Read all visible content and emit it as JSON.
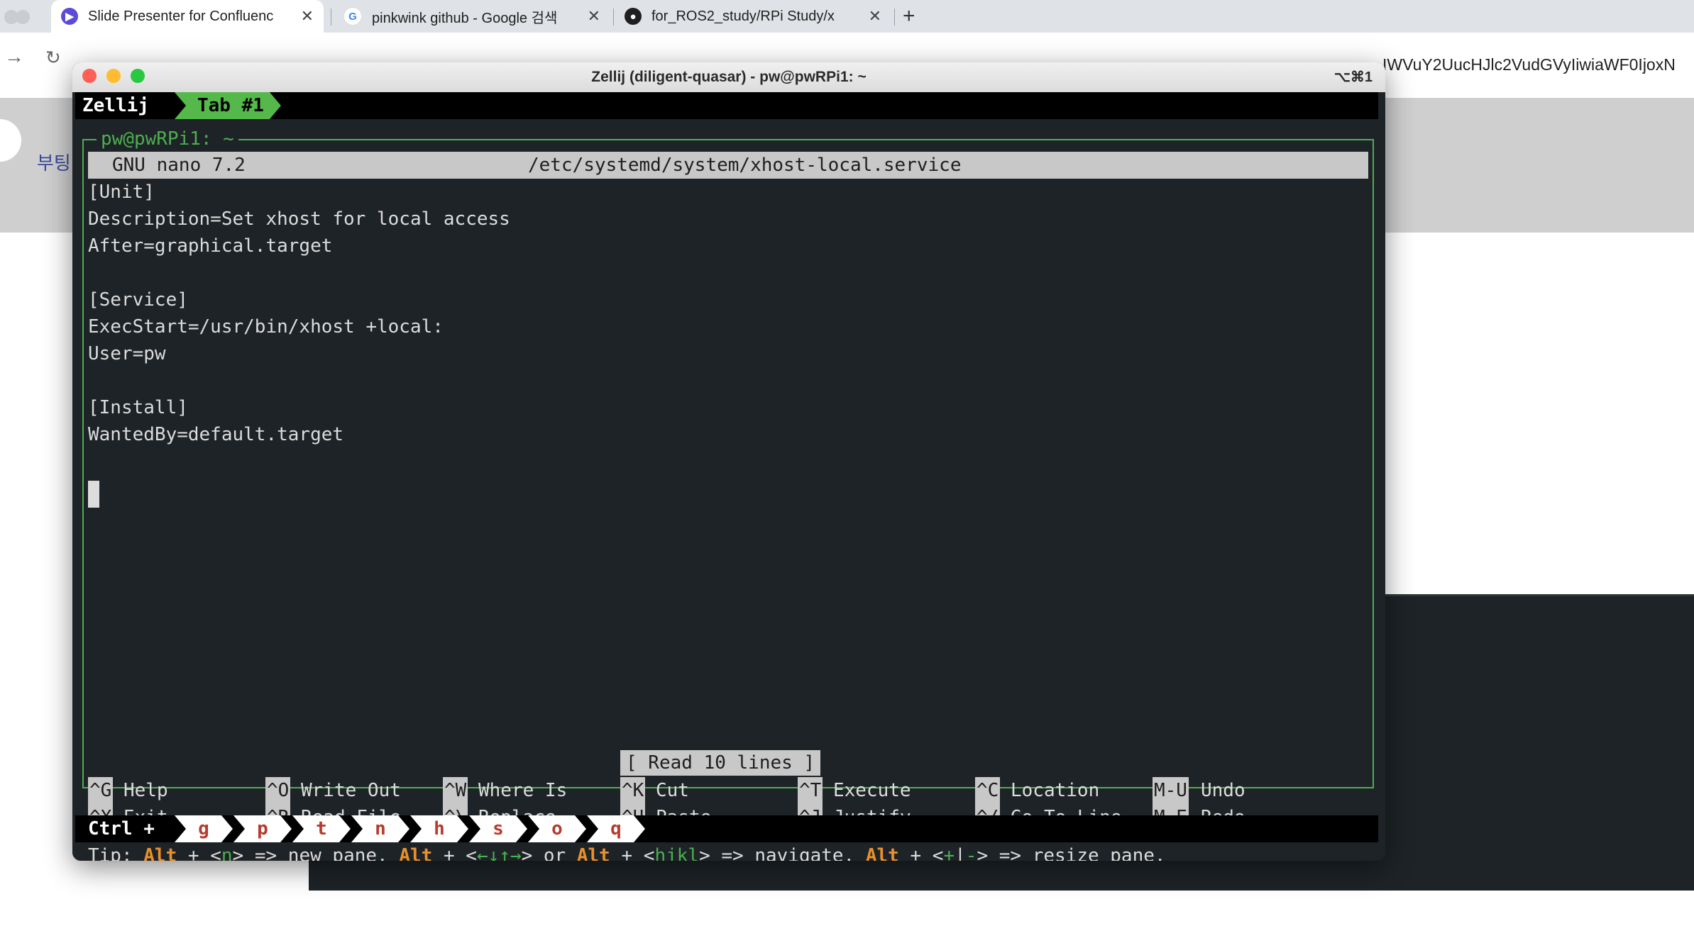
{
  "browser": {
    "tabs": [
      {
        "title": "Slide Presenter for Confluenc",
        "icon": "slide-presenter-icon",
        "active": true
      },
      {
        "title": "pinkwink github - Google 검색",
        "icon": "google-icon",
        "active": false
      },
      {
        "title": "for_ROS2_study/RPi Study/x",
        "icon": "github-icon",
        "active": false
      }
    ],
    "close_glyph": "✕",
    "new_tab_glyph": "+",
    "url_fragment": "IWVuY2UucHJlc2VudGVyIiwiaWF0IjoxN",
    "page_side_text": "부팅"
  },
  "window": {
    "title": "Zellij (diligent-quasar) - pw@pwRPi1: ~",
    "shortcut": "⌥⌘1"
  },
  "zellij": {
    "name": "Zellij",
    "tab": "Tab #1",
    "pane_title": "pw@pwRPi1: ~",
    "ctrl_label": "Ctrl +",
    "ctrl_keys": [
      "g",
      "p",
      "t",
      "n",
      "h",
      "s",
      "o",
      "q"
    ],
    "tip": {
      "prefix": "Tip: ",
      "alt": "Alt",
      "p1": " + <",
      "k1": "n",
      "p2": "> => new pane. ",
      "p3": " + <",
      "k2": "←↓↑→",
      "p4": "> or ",
      "p5": " + <",
      "k3": "hjkl",
      "p6": "> => navigate. ",
      "p7": " + <",
      "k4": "+",
      "p8": "|",
      "k5": "-",
      "p9": "> => resize pane."
    }
  },
  "nano": {
    "version": "GNU nano 7.2",
    "file": "/etc/systemd/system/xhost-local.service",
    "lines": [
      "[Unit]",
      "Description=Set xhost for local access",
      "After=graphical.target",
      "",
      "[Service]",
      "ExecStart=/usr/bin/xhost +local:",
      "User=pw",
      "",
      "[Install]",
      "WantedBy=default.target"
    ],
    "status": "[ Read 10 lines ]",
    "help": [
      {
        "key": "^G",
        "label": "Help"
      },
      {
        "key": "^X",
        "label": "Exit"
      },
      {
        "key": "^O",
        "label": "Write Out"
      },
      {
        "key": "^R",
        "label": "Read File"
      },
      {
        "key": "^W",
        "label": "Where Is"
      },
      {
        "key": "^\\",
        "label": "Replace"
      },
      {
        "key": "^K",
        "label": "Cut"
      },
      {
        "key": "^U",
        "label": "Paste"
      },
      {
        "key": "^T",
        "label": "Execute"
      },
      {
        "key": "^J",
        "label": "Justify"
      },
      {
        "key": "^C",
        "label": "Location"
      },
      {
        "key": "^/",
        "label": "Go To Line"
      },
      {
        "key": "M-U",
        "label": "Undo"
      },
      {
        "key": "M-E",
        "label": "Redo"
      }
    ]
  },
  "colors": {
    "zellij_green": "#55b84a",
    "frame_green": "#4caf50",
    "tip_orange": "#e8902c",
    "ctrl_key_red": "#b73a2e"
  }
}
